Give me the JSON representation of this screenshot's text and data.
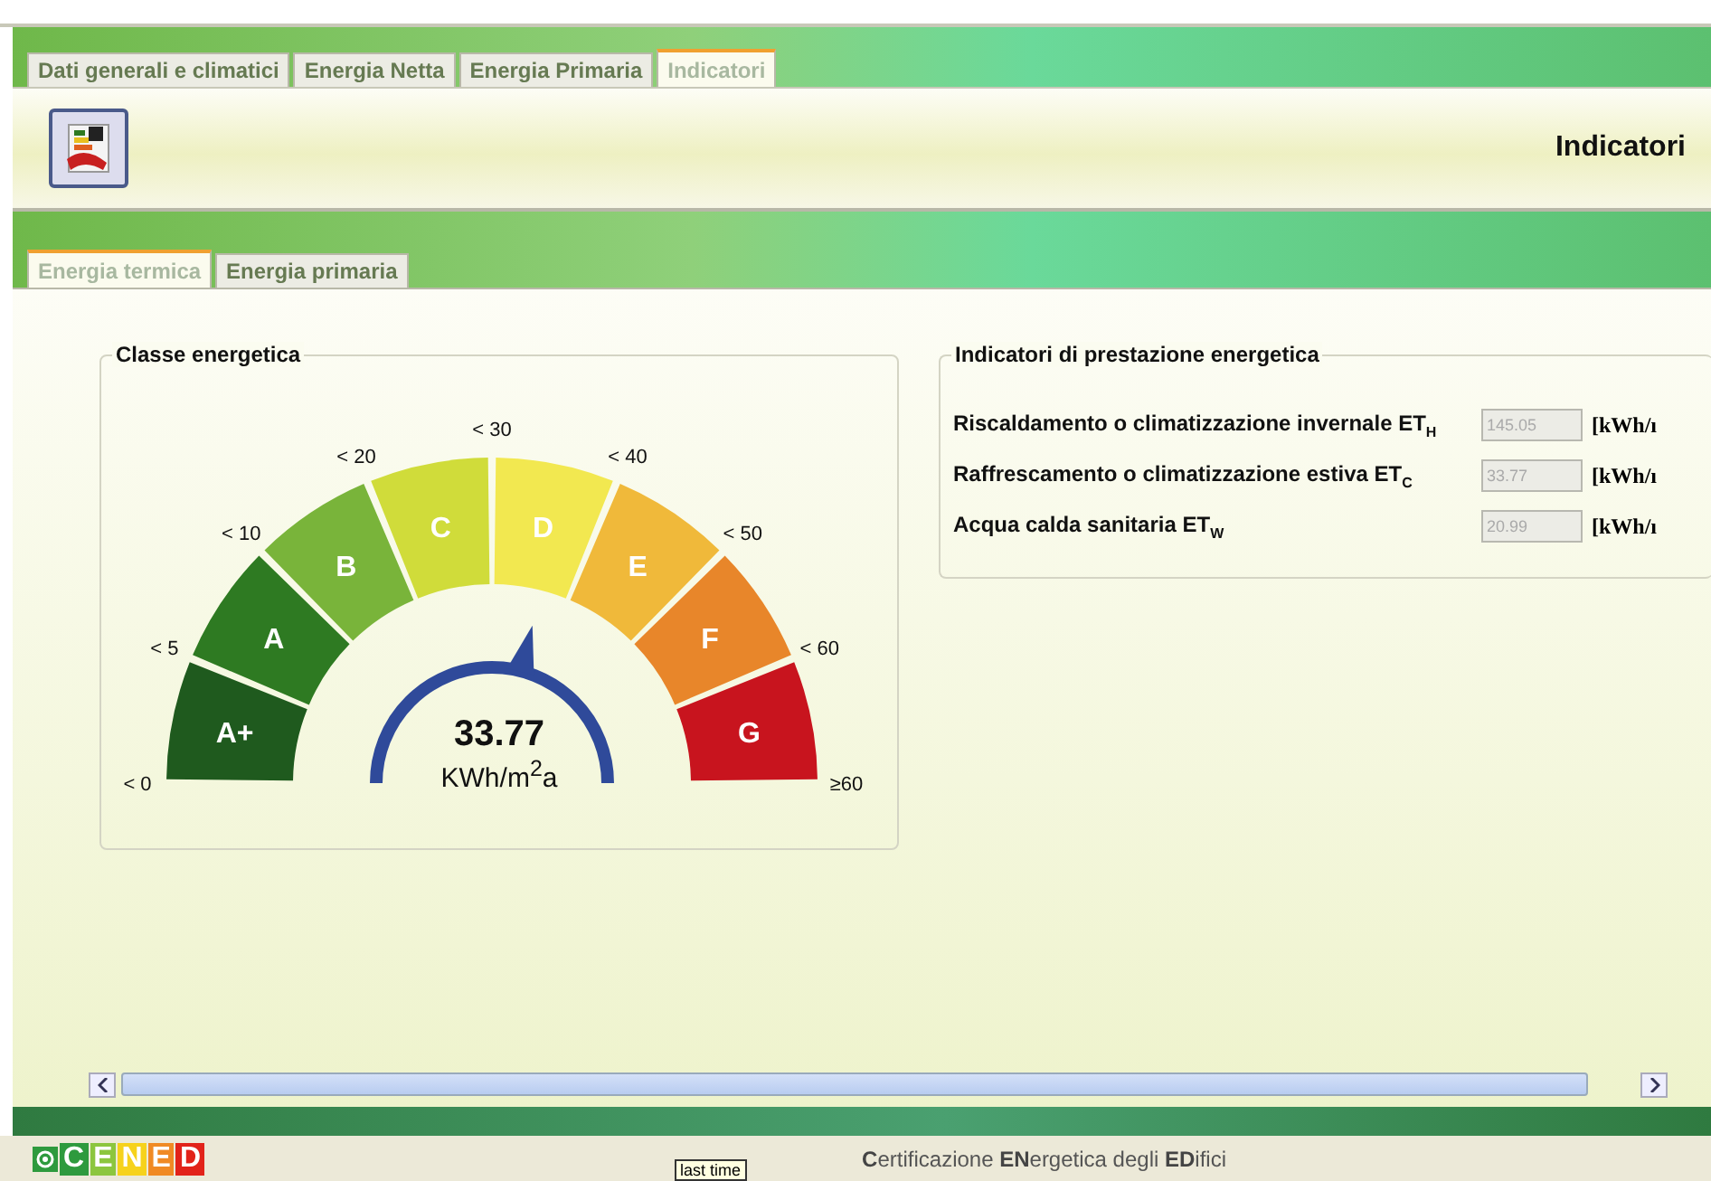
{
  "main_tabs": [
    {
      "label": "Dati generali e climatici",
      "selected": false
    },
    {
      "label": "Energia Netta",
      "selected": false
    },
    {
      "label": "Energia Primaria",
      "selected": false
    },
    {
      "label": "Indicatori",
      "selected": true
    }
  ],
  "header": {
    "title": "Indicatori"
  },
  "sub_tabs": [
    {
      "label": "Energia termica",
      "selected": true
    },
    {
      "label": "Energia primaria",
      "selected": false
    }
  ],
  "classe_energetica": {
    "title": "Classe energetica",
    "value": "33.77",
    "unit": "KWh/m$^{2}$a",
    "classes": [
      {
        "letter": "A+",
        "color": "#1f5a1e"
      },
      {
        "letter": "A",
        "color": "#2e7a22"
      },
      {
        "letter": "B",
        "color": "#79b43a"
      },
      {
        "letter": "C",
        "color": "#d0dc3a"
      },
      {
        "letter": "D",
        "color": "#f2e850"
      },
      {
        "letter": "E",
        "color": "#f0b93a"
      },
      {
        "letter": "F",
        "color": "#e8862a"
      },
      {
        "letter": "G",
        "color": "#c8141e"
      }
    ],
    "thresholds": [
      "< 0",
      "< 5",
      "< 10",
      "< 20",
      "< 30",
      "< 40",
      "< 50",
      "< 60",
      "≥60"
    ]
  },
  "indicatori": {
    "title": "Indicatori di prestazione energetica",
    "rows": [
      {
        "label": "Riscaldamento o climatizzazione invernale ET$_{H}$",
        "value": "145.05",
        "unit": "[kWh/ı"
      },
      {
        "label": "Raffrescamento o climatizzazione estiva ET$_{C}$",
        "value": "33.77",
        "unit": "[kWh/ı"
      },
      {
        "label": "Acqua calda sanitaria ET$_{W}$",
        "value": "20.99",
        "unit": "[kWh/ı"
      }
    ]
  },
  "footer": {
    "logo_letters": [
      "C",
      "E",
      "N",
      "E",
      "D"
    ],
    "tooltip": "last time",
    "tagline": "**C**ertificazione **EN**ergetica degli **ED**ifici"
  }
}
